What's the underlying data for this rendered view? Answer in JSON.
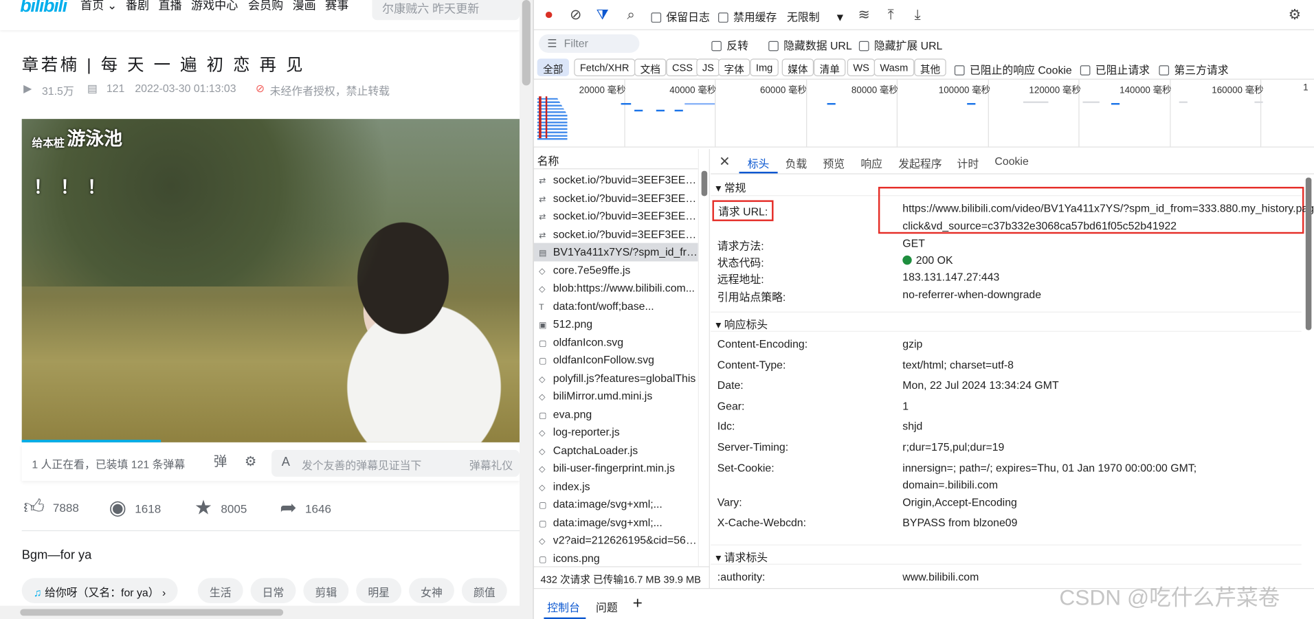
{
  "bili": {
    "logo": "bilibili",
    "nav": [
      "首页 ⌄",
      "番剧",
      "直播",
      "游戏中心",
      "会员购",
      "漫画",
      "赛事"
    ],
    "search_placeholder": "尔康贼六 昨天更新",
    "title": "章若楠 | 每 天 一 遍 初 恋 再 见",
    "views": "31.5万",
    "danmaku": "121",
    "date": "2022-03-30 01:13:03",
    "notice": "未经作者授权，禁止转载",
    "video_overlay": {
      "line1": "给本桩",
      "line2": "游泳池",
      "line3": "！！！"
    },
    "live_count": "1 人正在看，已装填 121 条弹幕",
    "danmu_placeholder": "发个友善的弹幕见证当下",
    "danmu_etiquette": "弹幕礼仪",
    "likes": "7888",
    "coins": "1618",
    "favorites": "8005",
    "shares": "1646",
    "description": "Bgm—for ya",
    "tags": [
      "给你呀（又名：for ya） ›",
      "生活",
      "日常",
      "剪辑",
      "明星",
      "女神",
      "颜值"
    ]
  },
  "devtools": {
    "toolbar": {
      "preserve_log": "保留日志",
      "disable_cache": "禁用缓存",
      "throttle": "无限制"
    },
    "filter": {
      "placeholder": "Filter",
      "invert": "反转",
      "hide_data_url": "隐藏数据 URL",
      "hide_ext_url": "隐藏扩展 URL"
    },
    "types": [
      "全部",
      "Fetch/XHR",
      "文档",
      "CSS",
      "JS",
      "字体",
      "Img",
      "媒体",
      "清单",
      "WS",
      "Wasm",
      "其他"
    ],
    "type_checks": [
      "已阻止的响应 Cookie",
      "已阻止请求",
      "第三方请求"
    ],
    "ticks": [
      "20000 毫秒",
      "40000 毫秒",
      "60000 毫秒",
      "80000 毫秒",
      "100000 毫秒",
      "120000 毫秒",
      "140000 毫秒",
      "160000 毫秒",
      "1"
    ],
    "list_header": "名称",
    "requests": [
      {
        "icon": "⇄",
        "name": "socket.io/?buvid=3EEF3EE1-4..."
      },
      {
        "icon": "⇄",
        "name": "socket.io/?buvid=3EEF3EE1-4..."
      },
      {
        "icon": "⇄",
        "name": "socket.io/?buvid=3EEF3EE1-4..."
      },
      {
        "icon": "⇄",
        "name": "socket.io/?buvid=3EEF3EE1-4..."
      },
      {
        "icon": "▤",
        "name": "BV1Ya411x7YS/?spm_id_from..."
      },
      {
        "icon": "◇",
        "name": "core.7e5e9ffe.js"
      },
      {
        "icon": "◇",
        "name": "blob:https://www.bilibili.com..."
      },
      {
        "icon": "T",
        "name": "data:font/woff;base..."
      },
      {
        "icon": "▣",
        "name": "512.png"
      },
      {
        "icon": "▢",
        "name": "oldfanIcon.svg"
      },
      {
        "icon": "▢",
        "name": "oldfanIconFollow.svg"
      },
      {
        "icon": "◇",
        "name": "polyfill.js?features=globalThis"
      },
      {
        "icon": "◇",
        "name": "biliMirror.umd.mini.js"
      },
      {
        "icon": "▢",
        "name": "eva.png"
      },
      {
        "icon": "◇",
        "name": "log-reporter.js"
      },
      {
        "icon": "◇",
        "name": "CaptchaLoader.js"
      },
      {
        "icon": "◇",
        "name": "bili-user-fingerprint.min.js"
      },
      {
        "icon": "◇",
        "name": "index.js"
      },
      {
        "icon": "▢",
        "name": "data:image/svg+xml;..."
      },
      {
        "icon": "▢",
        "name": "data:image/svg+xml;..."
      },
      {
        "icon": "◇",
        "name": "v2?aid=212626195&cid=562..."
      },
      {
        "icon": "▢",
        "name": "icons.png"
      }
    ],
    "status_bar": "432 次请求  已传输16.7 MB  39.9 MB",
    "detail_tabs": [
      "标头",
      "负载",
      "预览",
      "响应",
      "发起程序",
      "计时",
      "Cookie"
    ],
    "general": {
      "title": "常规",
      "url_key": "请求 URL:",
      "url_line1": "https://www.bilibili.com/video/BV1Ya411x7YS/?spm_id_from=333.880.my_history.page.",
      "url_line2": "click&vd_source=c37b332e3068ca57bd61f05c52b41922",
      "method_key": "请求方法:",
      "method": "GET",
      "status_key": "状态代码:",
      "status": "200 OK",
      "remote_key": "远程地址:",
      "remote": "183.131.147.27:443",
      "referrer_key": "引用站点策略:",
      "referrer": "no-referrer-when-downgrade"
    },
    "response_headers_title": "响应标头",
    "response_headers": [
      {
        "k": "Content-Encoding:",
        "v": "gzip"
      },
      {
        "k": "Content-Type:",
        "v": "text/html; charset=utf-8"
      },
      {
        "k": "Date:",
        "v": "Mon, 22 Jul 2024 13:34:24 GMT"
      },
      {
        "k": "Gear:",
        "v": "1"
      },
      {
        "k": "Idc:",
        "v": "shjd"
      },
      {
        "k": "Server-Timing:",
        "v": "r;dur=175,pul;dur=19"
      },
      {
        "k": "Set-Cookie:",
        "v": "innersign=; path=/; expires=Thu, 01 Jan 1970 00:00:00 GMT;",
        "v2": "domain=.bilibili.com"
      },
      {
        "k": "Vary:",
        "v": "Origin,Accept-Encoding"
      },
      {
        "k": "X-Cache-Webcdn:",
        "v": "BYPASS from blzone09"
      }
    ],
    "request_headers_title": "请求标头",
    "request_headers": [
      {
        "k": ":authority:",
        "v": "www.bilibili.com"
      }
    ],
    "drawer_tabs": [
      "控制台",
      "问题"
    ]
  },
  "watermark": "CSDN @吃什么芹菜卷"
}
